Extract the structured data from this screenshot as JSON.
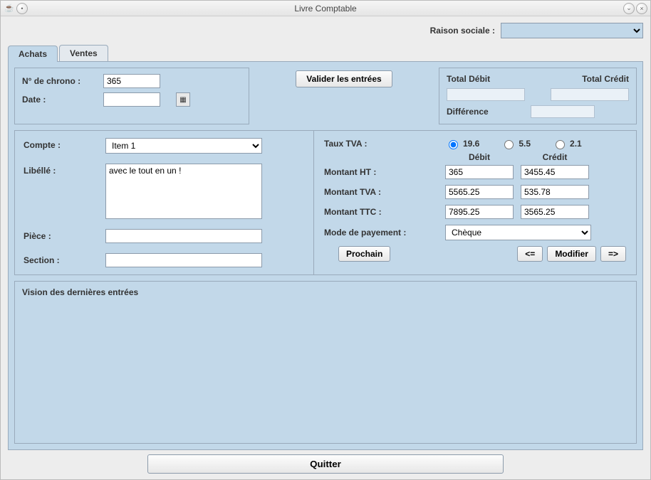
{
  "window": {
    "title": "Livre Comptable"
  },
  "header": {
    "raison_label": "Raison sociale :",
    "raison_value": ""
  },
  "tabs": {
    "achats": "Achats",
    "ventes": "Ventes"
  },
  "chrono": {
    "num_label": "N° de chrono :",
    "num_value": "365",
    "date_label": "Date  :",
    "date_value": ""
  },
  "valider_label": "Valider les entrées",
  "totals": {
    "debit_label": "Total Débit",
    "credit_label": "Total Crédit",
    "debit_value": "",
    "credit_value": "",
    "diff_label": "Différence",
    "diff_value": ""
  },
  "left": {
    "compte_label": "Compte  :",
    "compte_value": "Item 1",
    "libelle_label": "Libéllé   :",
    "libelle_value": "avec le tout en un !",
    "piece_label": "Pièce     :",
    "piece_value": "",
    "section_label": "Section :",
    "section_value": ""
  },
  "right": {
    "tva_label": "Taux TVA     :",
    "tva_options": {
      "r196": "19.6",
      "r55": "5.5",
      "r21": "2.1"
    },
    "tva_selected": "19.6",
    "debit_head": "Débit",
    "credit_head": "Crédit",
    "ht_label": "Montant HT   :",
    "ht_debit": "365",
    "ht_credit": "3455.45",
    "tva_amt_label": "Montant TVA :",
    "tva_debit": "5565.25",
    "tva_credit": "535.78",
    "ttc_label": "Montant TTC :",
    "ttc_debit": "7895.25",
    "ttc_credit": "3565.25",
    "pay_label": "Mode de payement :",
    "pay_value": "Chèque",
    "prochain": "Prochain",
    "prev": "<=",
    "modifier": "Modifier",
    "next": "=>"
  },
  "vision_label": "Vision des dernières entrées",
  "quit_label": "Quitter"
}
